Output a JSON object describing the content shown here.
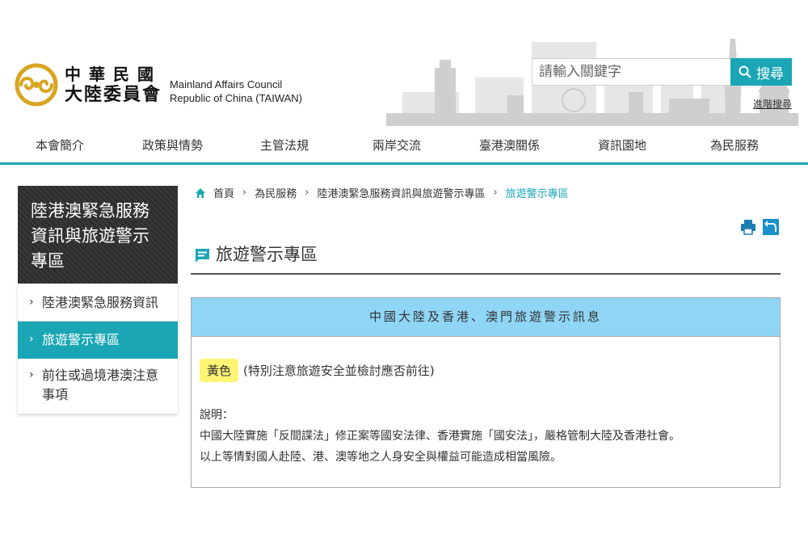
{
  "header": {
    "logo_cn_line1": "中華民國",
    "logo_cn_line2": "大陸委員會",
    "logo_en_line1": "Mainland Affairs Council",
    "logo_en_line2": "Republic of China (TAIWAN)",
    "search_placeholder": "請輸入關鍵字",
    "search_button": "搜尋",
    "advanced_search": "進階搜尋"
  },
  "nav": {
    "items": [
      {
        "label": "本會簡介"
      },
      {
        "label": "政策與情勢"
      },
      {
        "label": "主管法規"
      },
      {
        "label": "兩岸交流"
      },
      {
        "label": "臺港澳關係"
      },
      {
        "label": "資訊園地"
      },
      {
        "label": "為民服務"
      }
    ]
  },
  "sidebar": {
    "title": "陸港澳緊急服務資訊與旅遊警示專區",
    "items": [
      {
        "label": "陸港澳緊急服務資訊",
        "active": false
      },
      {
        "label": "旅遊警示專區",
        "active": true
      },
      {
        "label": "前往或過境港澳注意事項",
        "active": false
      }
    ]
  },
  "breadcrumb": {
    "items": [
      "首頁",
      "為民服務",
      "陸港澳緊急服務資訊與旅遊警示專區"
    ],
    "current": "旅遊警示專區"
  },
  "page": {
    "title": "旅遊警示專區"
  },
  "notice": {
    "heading": "中國大陸及香港、澳門旅遊警示訊息",
    "level_label": "黃色",
    "level_text": "(特別注意旅遊安全並檢討應否前往)",
    "desc_label": "說明：",
    "desc_line1": "中國大陸實施「反間諜法」修正案等國安法律、香港實施「國安法」，嚴格管制大陸及香港社會。",
    "desc_line2": "以上等情對國人赴陸、港、澳等地之人身安全與權益可能造成相當風險。"
  },
  "colors": {
    "accent": "#1aa6b4",
    "notice_header": "#8fd5f5",
    "badge_yellow": "#fff474",
    "sidebar_dark": "#2e2e2e",
    "logo_gold": "#d9a520"
  },
  "icons": {
    "logo": "mac-swirl-logo",
    "search": "search-icon",
    "home": "home-icon",
    "print": "print-icon",
    "back": "back-icon",
    "title": "message-icon"
  }
}
